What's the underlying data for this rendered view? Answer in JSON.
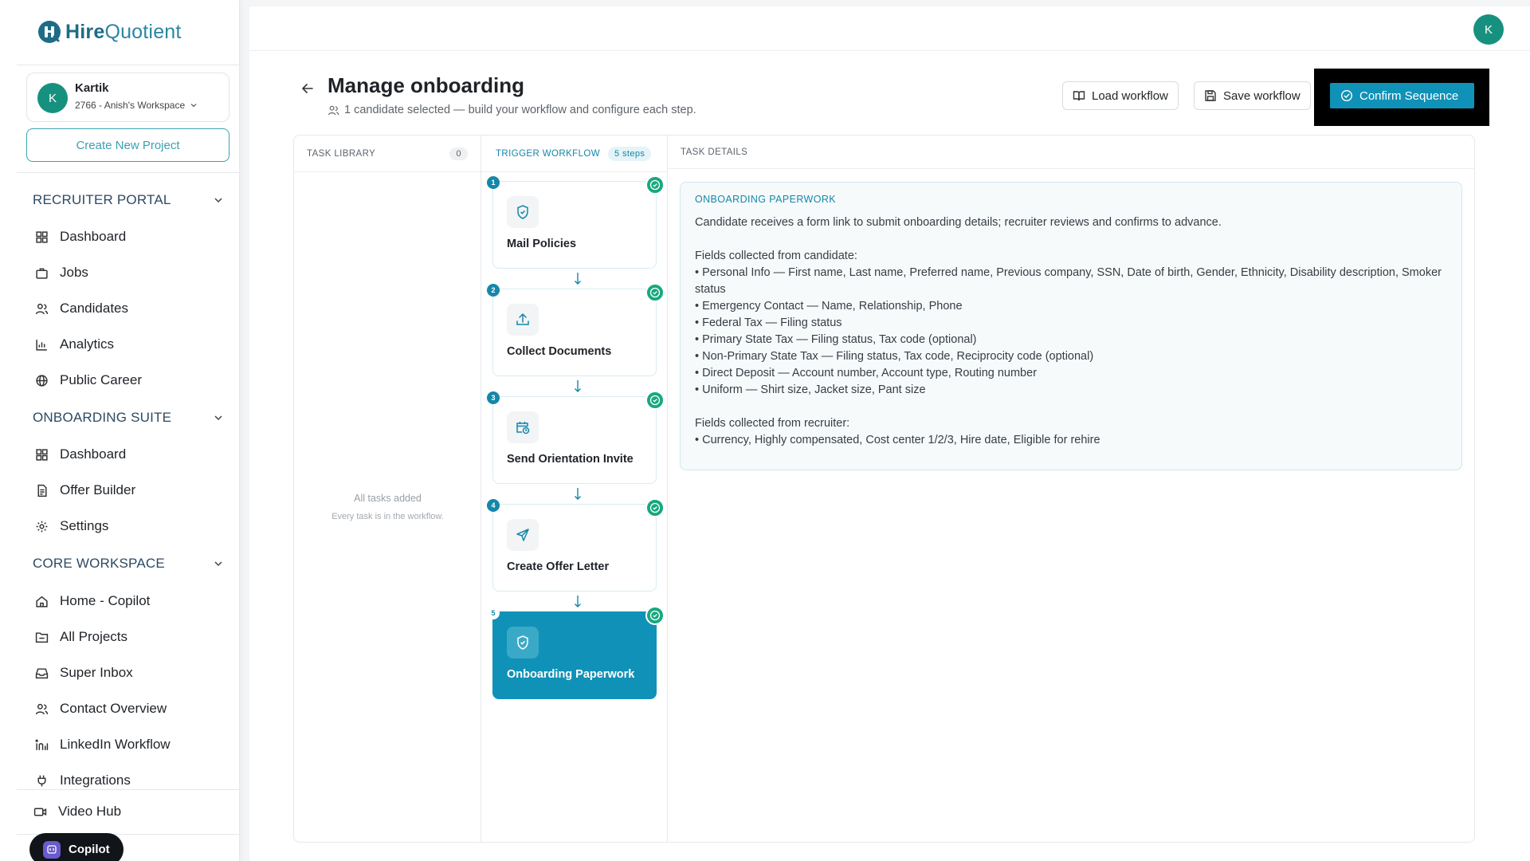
{
  "app": {
    "logo_bold": "Hire",
    "logo_light": "Quotient"
  },
  "workspace": {
    "avatar": "K",
    "name": "Kartik",
    "sub": "2766 - Anish's Workspace"
  },
  "sidebar": {
    "create_project": "Create New Project",
    "sections": [
      {
        "title": "RECRUITER PORTAL",
        "items": [
          "Dashboard",
          "Jobs",
          "Candidates",
          "Analytics",
          "Public Career"
        ]
      },
      {
        "title": "ONBOARDING SUITE",
        "items": [
          "Dashboard",
          "Offer Builder",
          "Settings"
        ]
      },
      {
        "title": "CORE WORKSPACE",
        "items": [
          "Home - Copilot",
          "All Projects",
          "Super Inbox",
          "Contact Overview",
          "LinkedIn Workflow",
          "Integrations"
        ]
      }
    ],
    "video_hub": "Video Hub",
    "copilot": "Copilot"
  },
  "header": {
    "user_avatar": "K",
    "title": "Manage onboarding",
    "subtitle": "1 candidate selected — build your workflow and configure each step.",
    "load_workflow": "Load workflow",
    "save_workflow": "Save workflow",
    "confirm_sequence": "Confirm Sequence"
  },
  "builder": {
    "library": {
      "title": "TASK LIBRARY",
      "count": "0",
      "empty_title": "All tasks added",
      "empty_sub": "Every task is in the workflow."
    },
    "workflow": {
      "title": "TRIGGER WORKFLOW",
      "steps_badge": "5 steps",
      "steps": [
        {
          "num": "1",
          "label": "Mail Policies",
          "icon": "shield-icon"
        },
        {
          "num": "2",
          "label": "Collect Documents",
          "icon": "upload-icon"
        },
        {
          "num": "3",
          "label": "Send Orientation Invite",
          "icon": "calendar-clock-icon"
        },
        {
          "num": "4",
          "label": "Create Offer Letter",
          "icon": "send-icon"
        },
        {
          "num": "5",
          "label": "Onboarding Paperwork",
          "icon": "shield-icon",
          "active": true
        }
      ]
    },
    "details": {
      "title": "TASK DETAILS",
      "box_title": "ONBOARDING PAPERWORK",
      "intro": "Candidate receives a form link to submit onboarding details; recruiter reviews and confirms to advance.",
      "candidate_heading": "Fields collected from candidate:",
      "candidate_fields": [
        "• Personal Info — First name, Last name, Preferred name, Previous company, SSN, Date of birth, Gender, Ethnicity, Disability description, Smoker status",
        "• Emergency Contact — Name, Relationship, Phone",
        "• Federal Tax — Filing status",
        "• Primary State Tax — Filing status, Tax code (optional)",
        "• Non-Primary State Tax — Filing status, Tax code, Reciprocity code (optional)",
        "• Direct Deposit — Account number, Account type, Routing number",
        "• Uniform — Shirt size, Jacket size, Pant size"
      ],
      "recruiter_heading": "Fields collected from recruiter:",
      "recruiter_fields": [
        "• Currency, Highly compensated, Cost center 1/2/3, Hire date, Eligible for rehire"
      ]
    }
  },
  "colors": {
    "accent": "#1092b8",
    "avatar": "#17917f",
    "check": "#17a87f"
  }
}
